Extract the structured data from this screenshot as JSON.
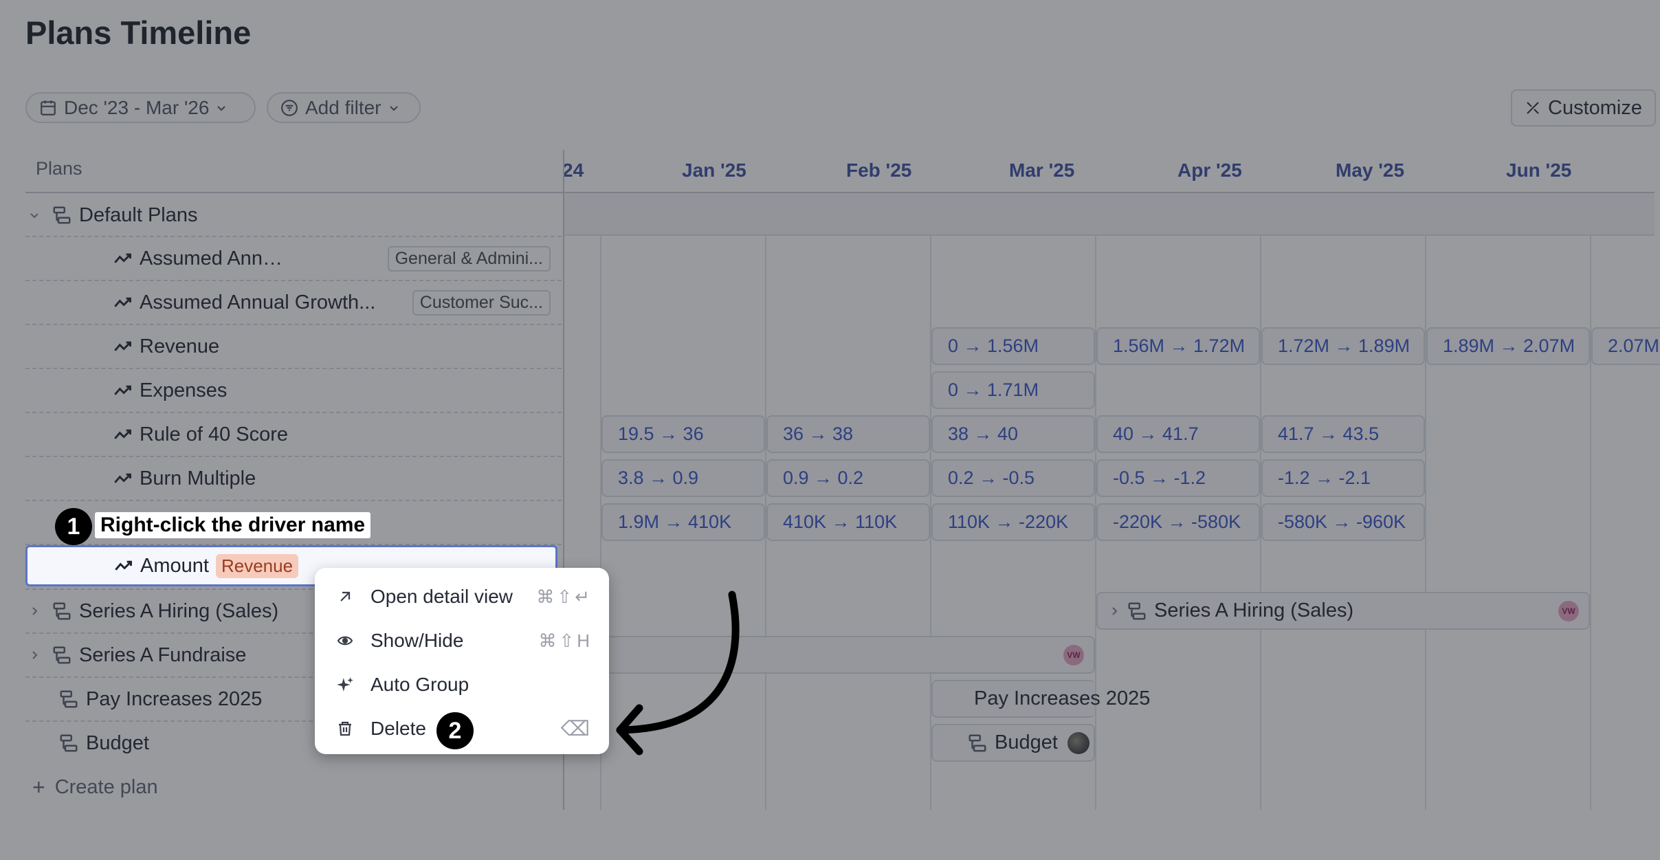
{
  "page": {
    "title": "Plans Timeline"
  },
  "toolbar": {
    "date_range": "Dec '23 - Mar '26",
    "add_filter": "Add filter",
    "customize": "Customize"
  },
  "table": {
    "plans_header": "Plans",
    "create_plan": "Create plan"
  },
  "timeline": {
    "months": [
      "24",
      "Jan '25",
      "Feb '25",
      "Mar '25",
      "Apr '25",
      "May '25",
      "Jun '25"
    ]
  },
  "rows": {
    "default_plans": "Default Plans",
    "assumed_annual": {
      "label": "Assumed Annual...",
      "tag": "General & Admini..."
    },
    "assumed_growth": {
      "label": "Assumed Annual Growth...",
      "tag": "Customer Suc..."
    },
    "revenue": "Revenue",
    "expenses": "Expenses",
    "rule40": "Rule of 40 Score",
    "burn": "Burn Multiple",
    "amount": {
      "label": "Amount",
      "tag": "Revenue"
    },
    "series_a_hiring": "Series A Hiring (Sales)",
    "series_a_fundraise": "Series A Fundraise",
    "pay_increases": "Pay Increases 2025",
    "budget": "Budget"
  },
  "cells": {
    "revenue": [
      "0 → 1.56M",
      "1.56M → 1.72M",
      "1.72M → 1.89M",
      "1.89M → 2.07M",
      "2.07M"
    ],
    "expenses": [
      "0 → 1.71M"
    ],
    "rule40": [
      "19.5 → 36",
      "36 → 38",
      "38 → 40",
      "40 → 41.7",
      "41.7 → 43.5"
    ],
    "burn": [
      "3.8 → 0.9",
      "0.9 → 0.2",
      "0.2 → -0.5",
      "-0.5 → -1.2",
      "-1.2 → -2.1"
    ],
    "row7": [
      "1.9M → 410K",
      "410K → 110K",
      "110K → -220K",
      "-220K → -580K",
      "-580K → -960K"
    ]
  },
  "bars": {
    "series_a_hiring": "Series A Hiring (Sales)",
    "pay_increases": "Pay Increases 2025",
    "budget": "Budget",
    "avatar_initials": "VW"
  },
  "callouts": {
    "step1_number": "1",
    "step1_text": "Right-click the driver name",
    "step2_number": "2"
  },
  "context_menu": {
    "items": [
      {
        "label": "Open detail view",
        "shortcut": "⌘⇧↵",
        "icon": "arrow-up-right-icon"
      },
      {
        "label": "Show/Hide",
        "shortcut": "⌘⇧H",
        "icon": "eye-icon"
      },
      {
        "label": "Auto Group",
        "shortcut": "",
        "icon": "sparkle-icon"
      },
      {
        "label": "Delete",
        "shortcut": "⌫",
        "icon": "trash-icon"
      }
    ]
  },
  "colors": {
    "accent": "#3452c8",
    "revenue_tag": "#f7cbbb",
    "overlay": "rgba(40,44,52,0.48)"
  }
}
